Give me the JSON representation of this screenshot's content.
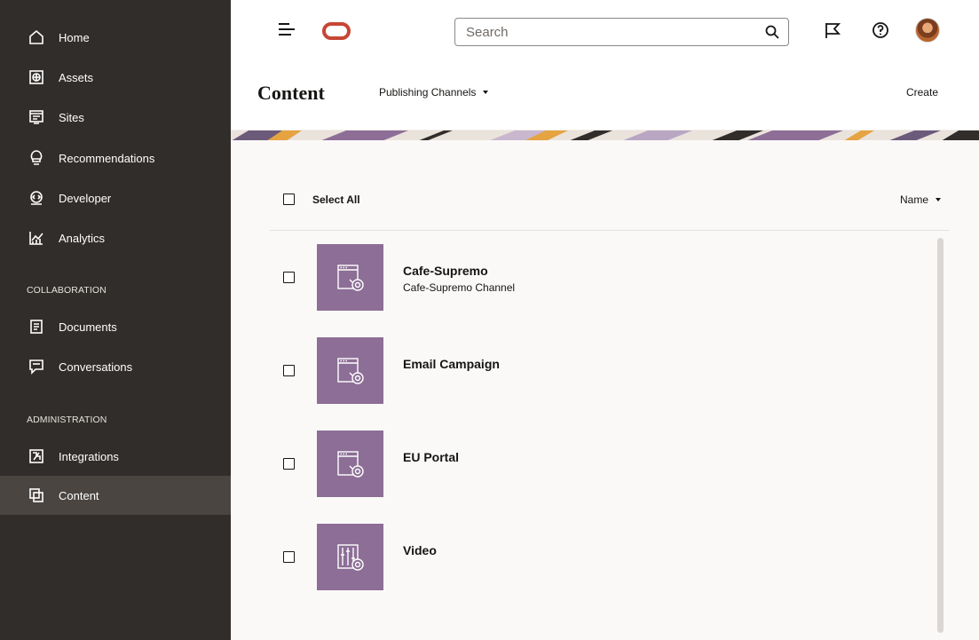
{
  "sidebar": {
    "items": [
      {
        "label": "Home",
        "icon": "home-icon"
      },
      {
        "label": "Assets",
        "icon": "assets-icon"
      },
      {
        "label": "Sites",
        "icon": "sites-icon"
      },
      {
        "label": "Recommendations",
        "icon": "lightbulb-icon"
      },
      {
        "label": "Developer",
        "icon": "developer-icon"
      },
      {
        "label": "Analytics",
        "icon": "analytics-icon"
      }
    ],
    "collaboration_label": "COLLABORATION",
    "collaboration_items": [
      {
        "label": "Documents",
        "icon": "documents-icon"
      },
      {
        "label": "Conversations",
        "icon": "conversations-icon"
      }
    ],
    "administration_label": "ADMINISTRATION",
    "administration_items": [
      {
        "label": "Integrations",
        "icon": "integrations-icon"
      },
      {
        "label": "Content",
        "icon": "content-icon",
        "active": true
      }
    ]
  },
  "topbar": {
    "search_placeholder": "Search",
    "icons": [
      "menu-icon",
      "oracle-logo",
      "search-icon",
      "flag-icon",
      "help-icon",
      "avatar"
    ]
  },
  "header": {
    "title": "Content",
    "channels_dropdown": "Publishing Channels",
    "create_label": "Create"
  },
  "list": {
    "select_all_label": "Select All",
    "sort_label": "Name",
    "items": [
      {
        "name": "Cafe-Supremo",
        "description": "Cafe-Supremo Channel",
        "icon": "web-channel-icon"
      },
      {
        "name": "Email Campaign",
        "description": "",
        "icon": "web-channel-icon"
      },
      {
        "name": "EU Portal",
        "description": "",
        "icon": "web-channel-icon"
      },
      {
        "name": "Video",
        "description": "",
        "icon": "video-channel-icon"
      }
    ]
  },
  "colors": {
    "sidebar_bg": "#312d2a",
    "sidebar_active": "#4a4541",
    "tile_bg": "#8d6e96",
    "oracle_red": "#c74634",
    "page_bg": "#fbf9f8"
  }
}
